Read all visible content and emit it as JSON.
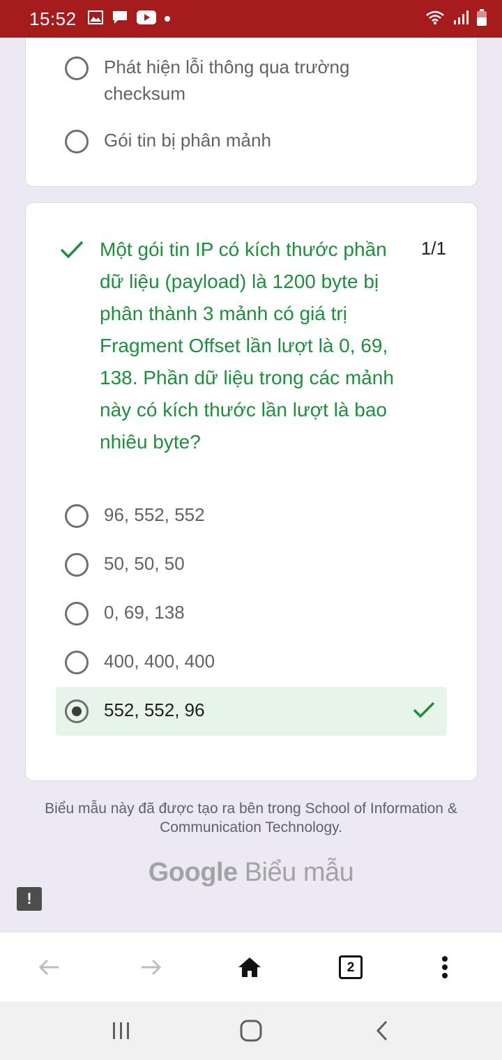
{
  "status_bar": {
    "time": "15:52",
    "left_icons": [
      "image-icon",
      "message-icon",
      "youtube-icon",
      "dot-icon"
    ],
    "right_icons": [
      "wifi-icon",
      "signal-icon",
      "battery-icon"
    ]
  },
  "previous_question": {
    "options": [
      "Phát hiện lỗi thông qua trường checksum",
      "Gói tin bị phân mảnh"
    ]
  },
  "question": {
    "text": "Một gói tin IP có kích thước phần dữ liệu (payload) là 1200 byte bị phân thành 3 mảnh có giá trị Fragment Offset lần lượt là 0, 69, 138. Phần dữ liệu trong các mảnh này có kích thước lần lượt là bao nhiêu byte?",
    "score": "1/1",
    "options": [
      "96, 552, 552",
      "50, 50, 50",
      "0, 69, 138",
      "400, 400, 400"
    ],
    "selected_answer": "552, 552, 96"
  },
  "footer": {
    "note": "Biểu mẫu này đã được tạo ra bên trong School of Information & Communication Technology.",
    "brand_google": "Google",
    "brand_forms": "Biểu mẫu",
    "report_label": "!"
  },
  "browser": {
    "tab_count": "2"
  },
  "colors": {
    "status_bar": "#a61c1c",
    "correct_green": "#1e8e3e",
    "answer_bg": "#e6f4ea",
    "page_bg": "#ece8f4"
  }
}
